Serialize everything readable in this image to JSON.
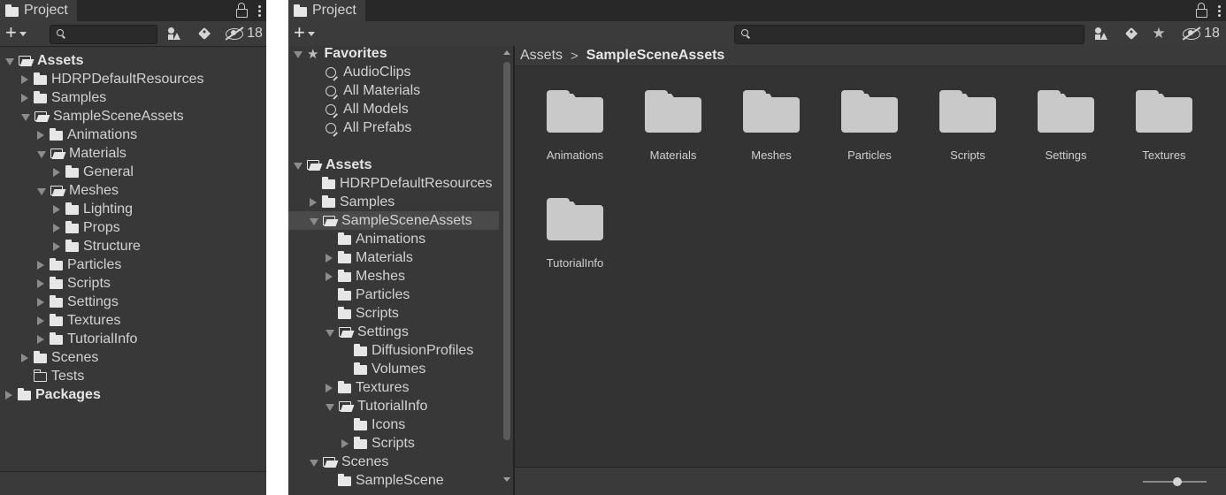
{
  "left_panel": {
    "tab_label": "Project",
    "search_placeholder": "",
    "hidden_count": "18",
    "tree": [
      {
        "label": "Assets",
        "depth": 0,
        "state": "open",
        "bold": true
      },
      {
        "label": "HDRPDefaultResources",
        "depth": 1,
        "state": "closed"
      },
      {
        "label": "Samples",
        "depth": 1,
        "state": "closed"
      },
      {
        "label": "SampleSceneAssets",
        "depth": 1,
        "state": "open"
      },
      {
        "label": "Animations",
        "depth": 2,
        "state": "closed"
      },
      {
        "label": "Materials",
        "depth": 2,
        "state": "open"
      },
      {
        "label": "General",
        "depth": 3,
        "state": "closed"
      },
      {
        "label": "Meshes",
        "depth": 2,
        "state": "open"
      },
      {
        "label": "Lighting",
        "depth": 3,
        "state": "closed"
      },
      {
        "label": "Props",
        "depth": 3,
        "state": "closed"
      },
      {
        "label": "Structure",
        "depth": 3,
        "state": "closed"
      },
      {
        "label": "Particles",
        "depth": 2,
        "state": "closed"
      },
      {
        "label": "Scripts",
        "depth": 2,
        "state": "closed"
      },
      {
        "label": "Settings",
        "depth": 2,
        "state": "closed"
      },
      {
        "label": "Textures",
        "depth": 2,
        "state": "closed"
      },
      {
        "label": "TutorialInfo",
        "depth": 2,
        "state": "closed"
      },
      {
        "label": "Scenes",
        "depth": 1,
        "state": "closed"
      },
      {
        "label": "Tests",
        "depth": 1,
        "state": "empty"
      },
      {
        "label": "Packages",
        "depth": 0,
        "state": "closed",
        "bold": true
      }
    ]
  },
  "right_panel": {
    "tab_label": "Project",
    "search_placeholder": "",
    "hidden_count": "18",
    "favorites": {
      "label": "Favorites",
      "items": [
        "AudioClips",
        "All Materials",
        "All Models",
        "All Prefabs"
      ]
    },
    "tree": [
      {
        "label": "Assets",
        "depth": 0,
        "state": "open",
        "bold": true
      },
      {
        "label": "HDRPDefaultResources",
        "depth": 1,
        "state": "leaf"
      },
      {
        "label": "Samples",
        "depth": 1,
        "state": "closed"
      },
      {
        "label": "SampleSceneAssets",
        "depth": 1,
        "state": "open",
        "selected": true
      },
      {
        "label": "Animations",
        "depth": 2,
        "state": "leaf"
      },
      {
        "label": "Materials",
        "depth": 2,
        "state": "closed"
      },
      {
        "label": "Meshes",
        "depth": 2,
        "state": "closed"
      },
      {
        "label": "Particles",
        "depth": 2,
        "state": "leaf"
      },
      {
        "label": "Scripts",
        "depth": 2,
        "state": "leaf"
      },
      {
        "label": "Settings",
        "depth": 2,
        "state": "open"
      },
      {
        "label": "DiffusionProfiles",
        "depth": 3,
        "state": "leaf"
      },
      {
        "label": "Volumes",
        "depth": 3,
        "state": "leaf"
      },
      {
        "label": "Textures",
        "depth": 2,
        "state": "closed"
      },
      {
        "label": "TutorialInfo",
        "depth": 2,
        "state": "open"
      },
      {
        "label": "Icons",
        "depth": 3,
        "state": "leaf"
      },
      {
        "label": "Scripts",
        "depth": 3,
        "state": "closed"
      },
      {
        "label": "Scenes",
        "depth": 1,
        "state": "open"
      },
      {
        "label": "SampleScene",
        "depth": 2,
        "state": "leaf"
      }
    ],
    "breadcrumb": {
      "root": "Assets",
      "separator": ">",
      "current": "SampleSceneAssets"
    },
    "grid_items": [
      "Animations",
      "Materials",
      "Meshes",
      "Particles",
      "Scripts",
      "Settings",
      "Textures",
      "TutorialInfo"
    ],
    "zoom_level": 0.55
  },
  "colors": {
    "panel_bg": "#383838",
    "content_bg": "#333333",
    "tab_bar_bg": "#282828",
    "selection_bg": "#4a4a4a",
    "folder_icon": "#c9c9c9"
  }
}
